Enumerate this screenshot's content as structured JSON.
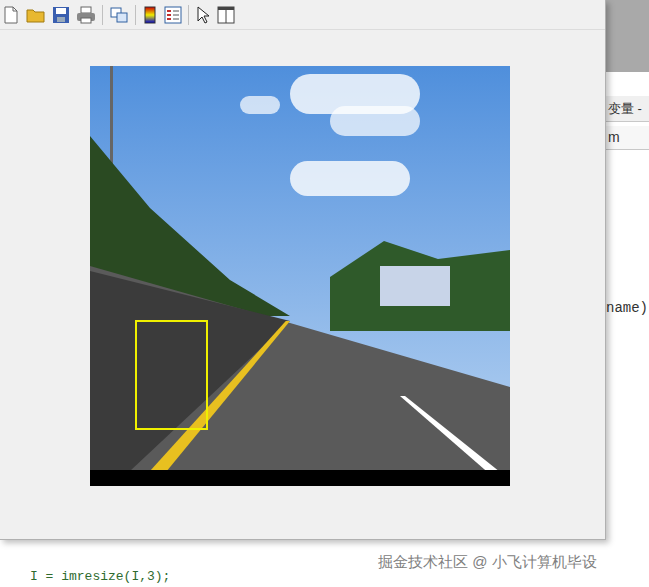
{
  "background_window": {
    "tab_label": "变量 -",
    "partial_texts": [
      "m",
      "name)"
    ],
    "code_line": "I = imresize(I,3);"
  },
  "watermark": "掘金技术社区 @ 小飞计算机毕设"
}
